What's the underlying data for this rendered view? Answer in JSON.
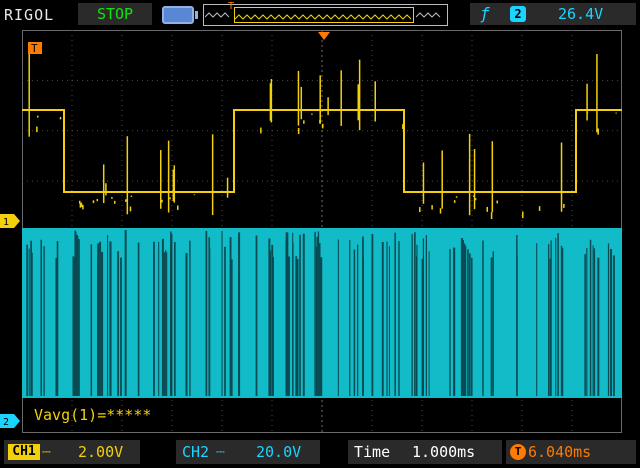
{
  "header": {
    "brand": "RIGOL",
    "run_state": "STOP",
    "trigger": {
      "edge_icon": "rising-edge-icon",
      "source": "2",
      "level": "26.4V"
    },
    "memory_marker": "T"
  },
  "screen": {
    "ch1_marker_label": "1",
    "ch2_marker_label": "2",
    "trigger_marker_label": "T",
    "measurement": "Vavg(1)=*****"
  },
  "footer": {
    "ch1": {
      "label": "CH1",
      "scale": "2.00V"
    },
    "ch2": {
      "label": "CH2",
      "scale": "20.0V"
    },
    "time": {
      "label": "Time",
      "value": "1.000ms"
    },
    "trigger_offset": {
      "value": "6.040ms"
    }
  },
  "colors": {
    "ch1": "#f2d10a",
    "ch2": "#1ad4ff",
    "trigger": "#ff7a00",
    "run_state": "#12e20f"
  }
}
